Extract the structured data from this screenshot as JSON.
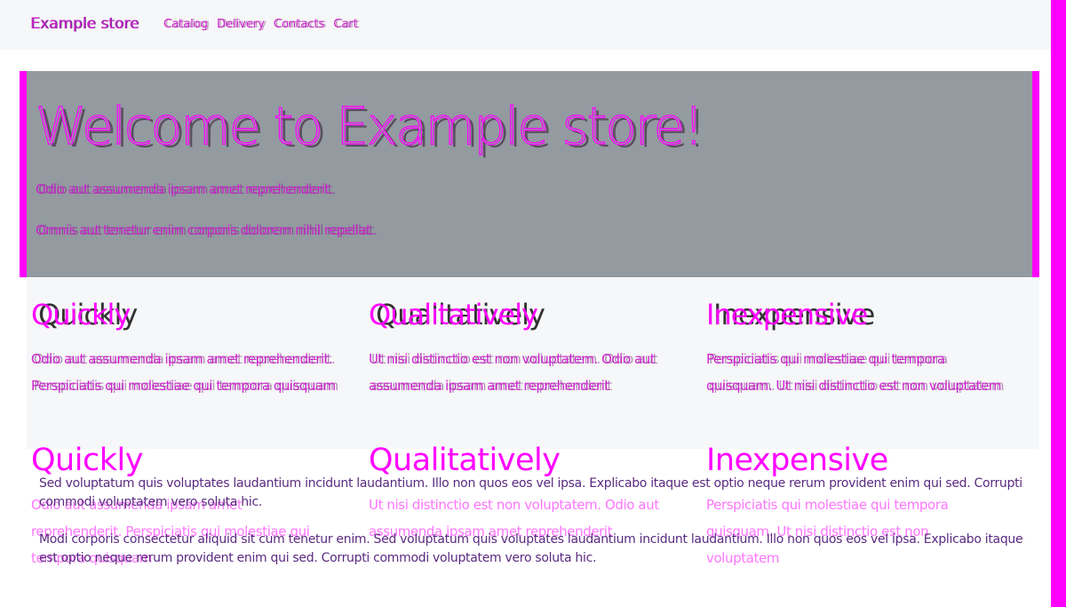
{
  "navbar": {
    "brand": "Example store",
    "links": [
      "Catalog",
      "Delivery",
      "Contacts",
      "Cart"
    ]
  },
  "hero": {
    "title": "Welcome to Example store!",
    "line1": "Odio aut assumenda ipsam amet reprehenderit.",
    "line2": "Omnis aut tenetur enim corporis dolorem nihil repellat."
  },
  "features": [
    {
      "title": "Quickly",
      "text": "Odio aut assumenda ipsam amet reprehenderit. Perspiciatis qui molestiae qui tempora quisquam"
    },
    {
      "title": "Qualitatively",
      "text": "Ut nisi distinctio est non voluptatem. Odio aut assumenda ipsam amet reprehenderit"
    },
    {
      "title": "Inexpensive",
      "text": "Perspiciatis qui molestiae qui tempora quisquam. Ut nisi distinctio est non voluptatem"
    }
  ],
  "footer": {
    "p1": "Sed voluptatum quis voluptates laudantium incidunt laudantium. Illo non quos eos vel ipsa. Explicabo itaque est optio neque rerum provident enim qui sed. Corrupti commodi voluptatem vero soluta hic.",
    "p2": "Modi corporis consectetur aliquid sit cum tenetur enim. Sed voluptatum quis voluptates laudantium incidunt laudantium. Illo non quos eos vel ipsa. Explicabo itaque est optio neque rerum provident enim qui sed. Corrupti commodi voluptatem vero soluta hic."
  },
  "colors": {
    "accent": "#ff00ff",
    "hero_bg": "#939aa0",
    "light_bg": "#f6f7f8"
  }
}
